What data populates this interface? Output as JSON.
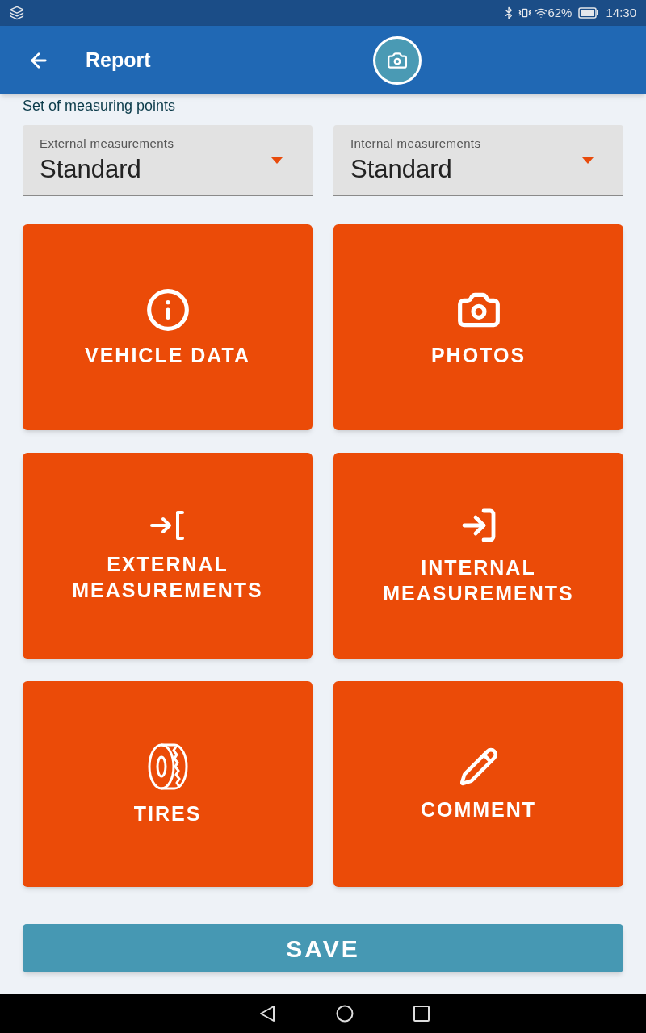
{
  "status_bar": {
    "battery_percent": "62%",
    "time": "14:30"
  },
  "header": {
    "title": "Report"
  },
  "section_label": "Set of measuring points",
  "dropdowns": [
    {
      "label": "External measurements",
      "value": "Standard"
    },
    {
      "label": "Internal measurements",
      "value": "Standard"
    }
  ],
  "tiles": [
    {
      "kind": "info",
      "label": "VEHICLE DATA"
    },
    {
      "kind": "camera",
      "label": "PHOTOS"
    },
    {
      "kind": "external",
      "label": "EXTERNAL MEASUREMENTS"
    },
    {
      "kind": "internal",
      "label": "INTERNAL MEASUREMENTS"
    },
    {
      "kind": "tire",
      "label": "TIRES"
    },
    {
      "kind": "pencil",
      "label": "COMMENT"
    }
  ],
  "save_button": "SAVE"
}
